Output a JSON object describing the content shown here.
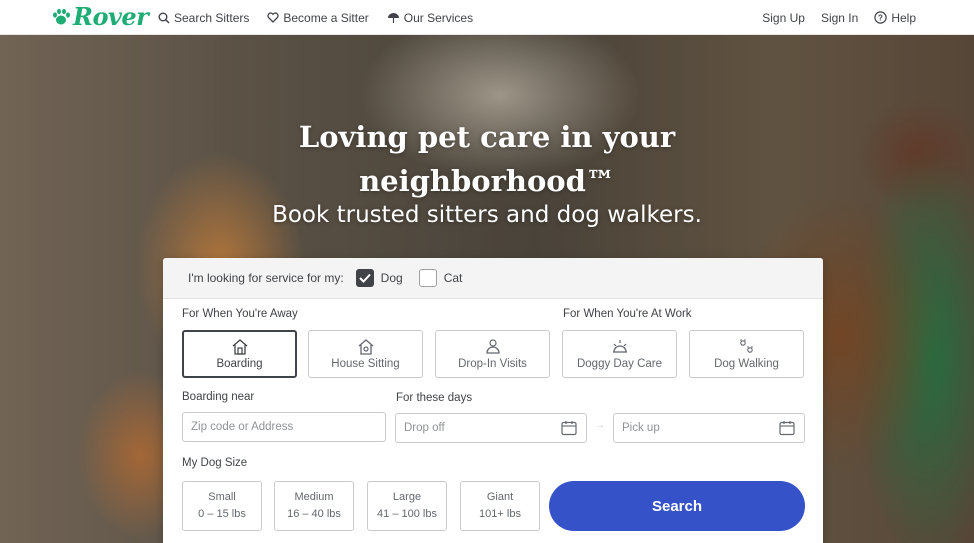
{
  "brand": {
    "name": "Rover",
    "color": "#1fad75"
  },
  "nav": {
    "links": [
      {
        "label": "Search Sitters",
        "icon": "search-icon"
      },
      {
        "label": "Become a Sitter",
        "icon": "heart-icon"
      },
      {
        "label": "Our Services",
        "icon": "paw-umbrella-icon"
      }
    ],
    "sign_up": "Sign Up",
    "sign_in": "Sign In",
    "help": "Help"
  },
  "hero": {
    "title_line1": "Loving pet care in your",
    "title_line2": "neighborhood™",
    "subtitle": "Book trusted sitters and dog walkers."
  },
  "search": {
    "looking_for": "I'm looking for service for my:",
    "pets": [
      {
        "label": "Dog",
        "checked": true
      },
      {
        "label": "Cat",
        "checked": false
      }
    ],
    "away_label": "For When You're Away",
    "work_label": "For When You're At Work",
    "services": [
      {
        "label": "Boarding",
        "icon": "house-icon",
        "selected": true
      },
      {
        "label": "House Sitting",
        "icon": "house-sitting-icon",
        "selected": false
      },
      {
        "label": "Drop-In Visits",
        "icon": "drop-in-icon",
        "selected": false
      },
      {
        "label": "Doggy Day Care",
        "icon": "sun-icon",
        "selected": false
      },
      {
        "label": "Dog Walking",
        "icon": "paw-prints-icon",
        "selected": false
      }
    ],
    "boarding_near_label": "Boarding near",
    "zip_placeholder": "Zip code or Address",
    "days_label": "For these days",
    "drop_off_placeholder": "Drop off",
    "pick_up_placeholder": "Pick up",
    "dog_size_label": "My Dog Size",
    "sizes": [
      {
        "name": "Small",
        "range": "0 – 15 lbs"
      },
      {
        "name": "Medium",
        "range": "16 – 40 lbs"
      },
      {
        "name": "Large",
        "range": "41 – 100 lbs"
      },
      {
        "name": "Giant",
        "range": "101+ lbs"
      }
    ],
    "search_button": "Search",
    "button_color": "#3552c8"
  }
}
